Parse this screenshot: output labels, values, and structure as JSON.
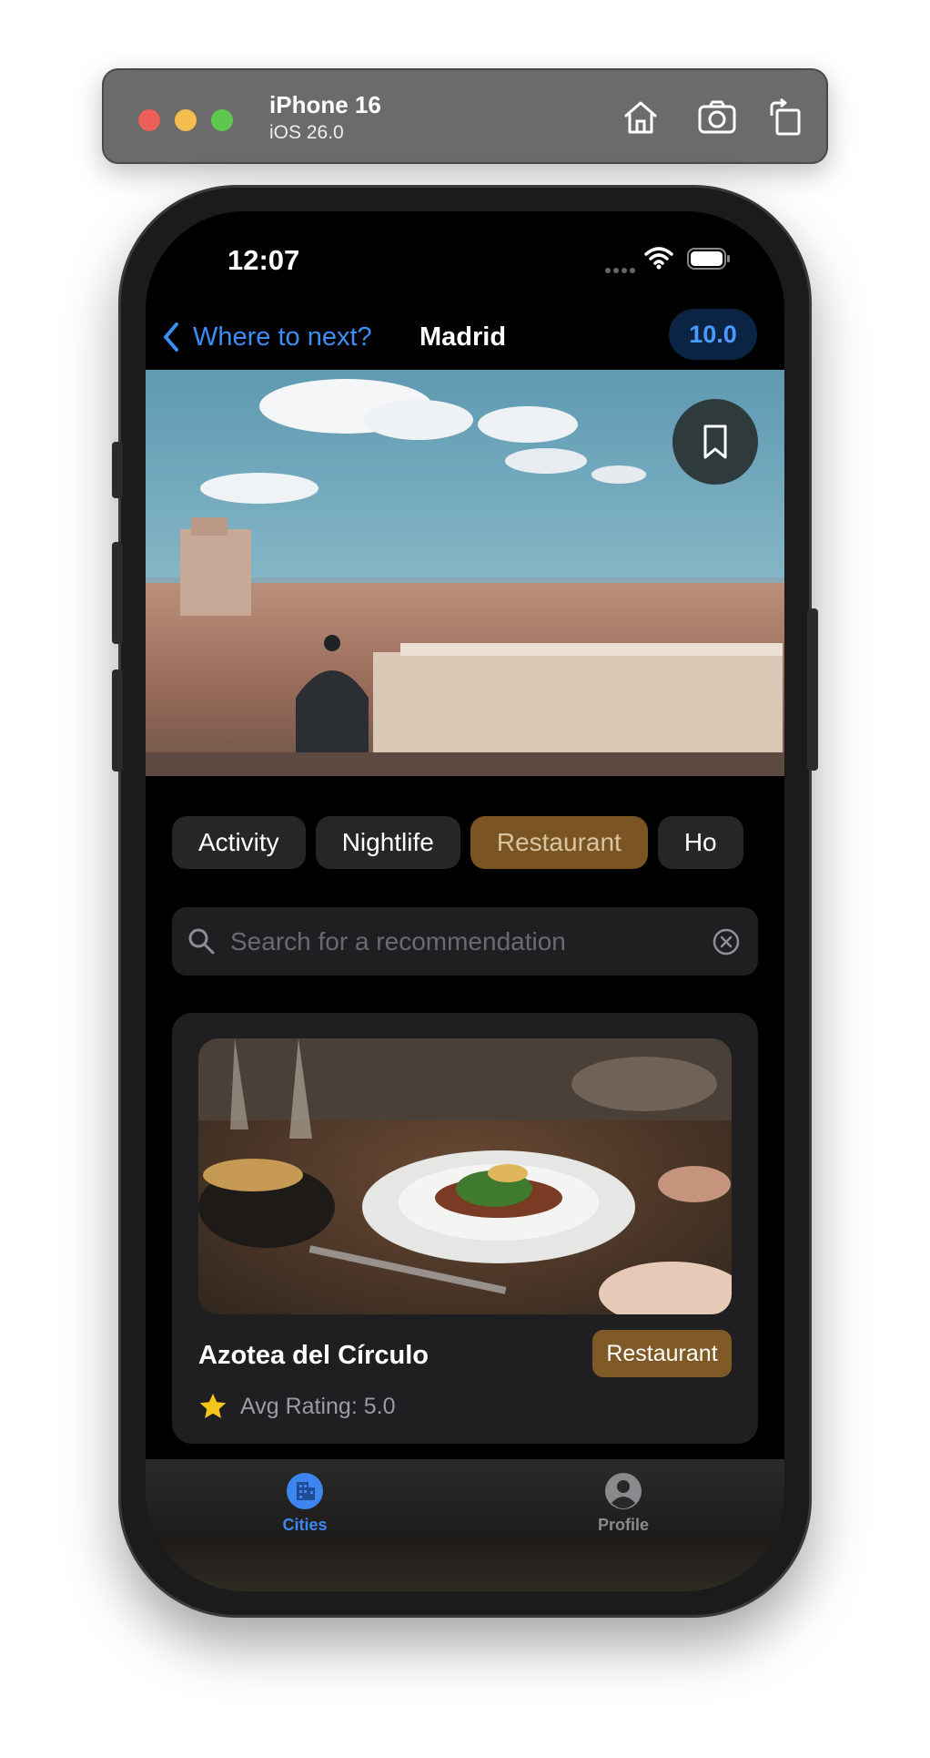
{
  "simulator": {
    "device_name": "iPhone 16",
    "os_version": "iOS 26.0",
    "toolbar_icons": [
      "home-icon",
      "screenshot-icon",
      "rotate-icon"
    ]
  },
  "status_bar": {
    "time": "12:07"
  },
  "nav": {
    "back_label": "Where to next?",
    "title": "Madrid",
    "score": "10.0"
  },
  "hero": {
    "image": "madrid-skyline-photo",
    "bookmark_icon": "bookmark-icon"
  },
  "filters": {
    "chips": [
      {
        "label": "Activity",
        "active": false
      },
      {
        "label": "Nightlife",
        "active": false
      },
      {
        "label": "Restaurant",
        "active": true
      },
      {
        "label": "Ho",
        "active": false
      }
    ]
  },
  "search": {
    "placeholder": "Search for a recommendation",
    "value": ""
  },
  "recommendations": [
    {
      "title": "Azotea del Círculo",
      "category": "Restaurant",
      "rating_text": "Avg Rating: 5.0",
      "image": "restaurant-dish-photo"
    }
  ],
  "tabbar": {
    "tabs": [
      {
        "label": "Cities",
        "icon": "building-icon",
        "selected": true
      },
      {
        "label": "Profile",
        "icon": "person-circle-icon",
        "selected": false
      }
    ]
  },
  "colors": {
    "accent_blue": "#3a8ef6",
    "chip_active": "#7a5523",
    "tag_restaurant": "#7f5926",
    "star": "#f5c518"
  }
}
